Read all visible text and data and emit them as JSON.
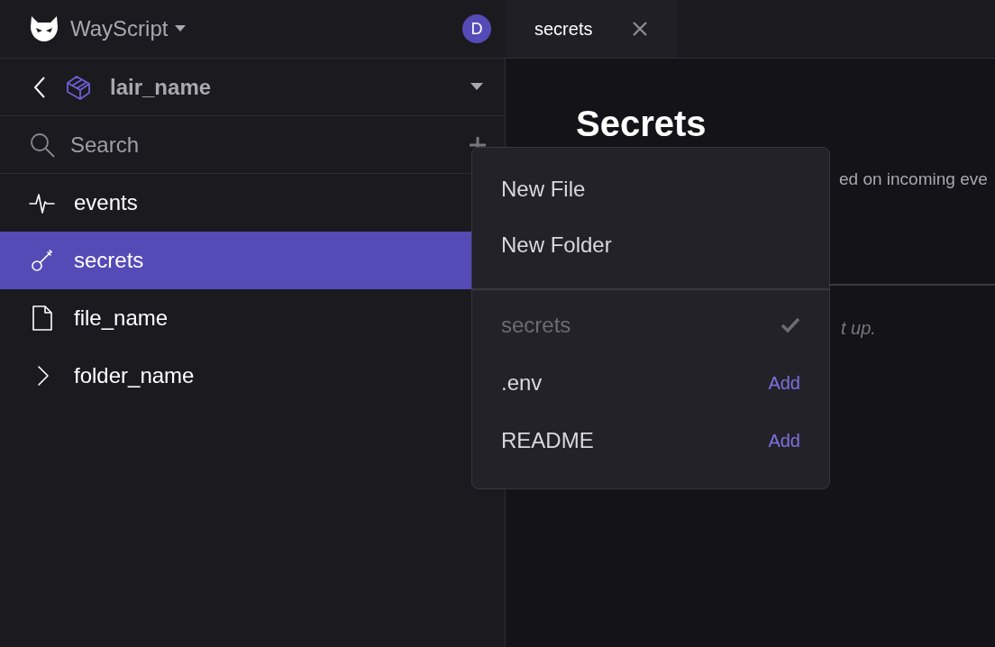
{
  "app": {
    "name": "WayScript",
    "avatar": "D"
  },
  "tabs": [
    {
      "label": "secrets",
      "selected": true
    }
  ],
  "lair": {
    "name": "lair_name"
  },
  "search": {
    "placeholder": "Search"
  },
  "tree": [
    {
      "label": "events",
      "kind": "events",
      "selected": false
    },
    {
      "label": "secrets",
      "kind": "secrets",
      "selected": true
    },
    {
      "label": "file_name",
      "kind": "file",
      "selected": false
    },
    {
      "label": "folder_name",
      "kind": "folder",
      "selected": false
    }
  ],
  "content": {
    "title": "Secrets",
    "description": "ed on incoming eve",
    "note": "t up."
  },
  "menu": {
    "actions": [
      "New File",
      "New Folder"
    ],
    "files": [
      {
        "label": "secrets",
        "disabled": true
      },
      {
        "label": ".env",
        "disabled": false,
        "action": "Add"
      },
      {
        "label": "README",
        "disabled": false,
        "action": "Add"
      }
    ]
  }
}
